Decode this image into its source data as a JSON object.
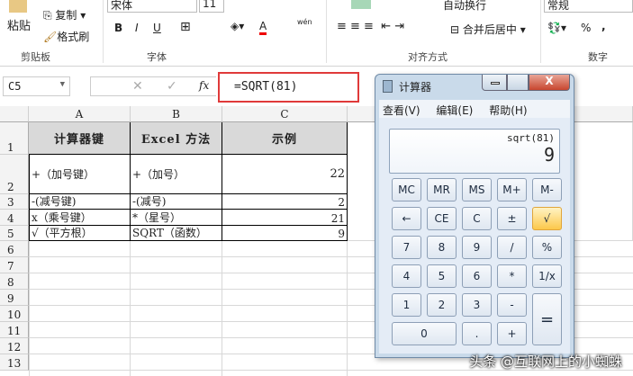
{
  "ribbon": {
    "paste": "粘贴",
    "copy": "复制",
    "format_painter": "格式刷",
    "font_name": "宋体",
    "font_size": "11",
    "bold": "B",
    "italic": "I",
    "underline": "U",
    "wen": "wén",
    "wrap_text": "自动换行",
    "merge_center": "合并后居中",
    "number_format": "常规",
    "percent": "%",
    "comma": ",",
    "groups": [
      "剪贴板",
      "字体",
      "对齐方式",
      "数字"
    ]
  },
  "formula_bar": {
    "name_box": "C5",
    "fx": "fx",
    "formula": "=SQRT(81)"
  },
  "sheet": {
    "columns": [
      "A",
      "B",
      "C"
    ],
    "rows": [
      "1",
      "2",
      "3",
      "4",
      "5",
      "6",
      "7",
      "8",
      "9",
      "10",
      "11",
      "12",
      "13"
    ],
    "header": [
      "计算器键",
      "Excel 方法",
      "示例"
    ],
    "data": [
      [
        "+（加号键）",
        "+（加号）",
        "22"
      ],
      [
        "-(减号键)",
        "-(减号)",
        "2"
      ],
      [
        "x（乘号键）",
        "*（星号）",
        "21"
      ],
      [
        "√（平方根）",
        "SQRT（函数）",
        "9"
      ]
    ]
  },
  "calculator": {
    "title": "计算器",
    "menu": [
      "查看(V)",
      "编辑(E)",
      "帮助(H)"
    ],
    "expression": "sqrt(81)",
    "result": "9",
    "keys": [
      [
        "MC",
        "MR",
        "MS",
        "M+",
        "M-"
      ],
      [
        "←",
        "CE",
        "C",
        "±",
        "√"
      ],
      [
        "7",
        "8",
        "9",
        "/",
        "%"
      ],
      [
        "4",
        "5",
        "6",
        "*",
        "1/x"
      ],
      [
        "1",
        "2",
        "3",
        "-"
      ],
      [
        "0",
        ".",
        "+"
      ]
    ],
    "equals": "=",
    "active_key": "√",
    "close": "X"
  },
  "watermark": "头条 @互联网上的小蜘蛛"
}
